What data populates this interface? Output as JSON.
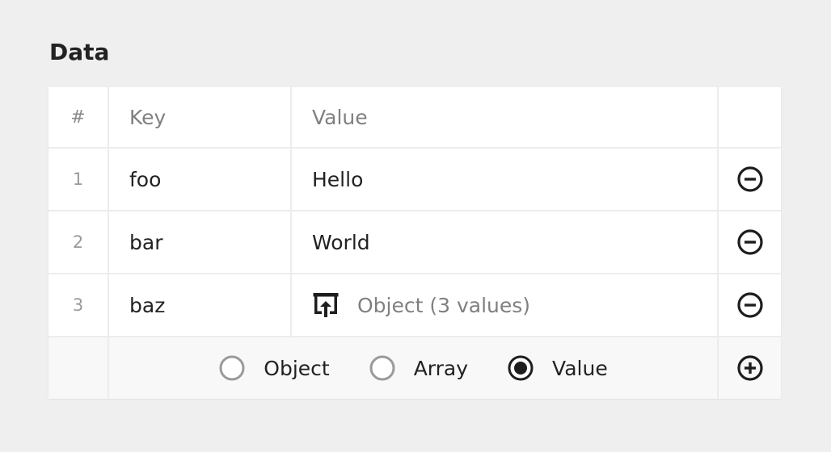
{
  "section": {
    "title": "Data"
  },
  "table": {
    "headers": {
      "num": "#",
      "key": "Key",
      "value": "Value"
    },
    "rows": [
      {
        "num": "1",
        "key": "foo",
        "value": "Hello",
        "type": "text"
      },
      {
        "num": "2",
        "key": "bar",
        "value": "World",
        "type": "text"
      },
      {
        "num": "3",
        "key": "baz",
        "value": "Object (3 values)",
        "type": "object"
      }
    ],
    "add_types": [
      {
        "label": "Object",
        "selected": false
      },
      {
        "label": "Array",
        "selected": false
      },
      {
        "label": "Value",
        "selected": true
      }
    ]
  },
  "icons": {
    "remove": "minus-circle-icon",
    "add": "plus-circle-icon",
    "expand_object": "open-object-icon"
  },
  "colors": {
    "background": "#efefef",
    "panel": "#ffffff",
    "footer": "#f8f8f8",
    "border": "#ececec",
    "text": "#222222",
    "muted": "#808080"
  }
}
